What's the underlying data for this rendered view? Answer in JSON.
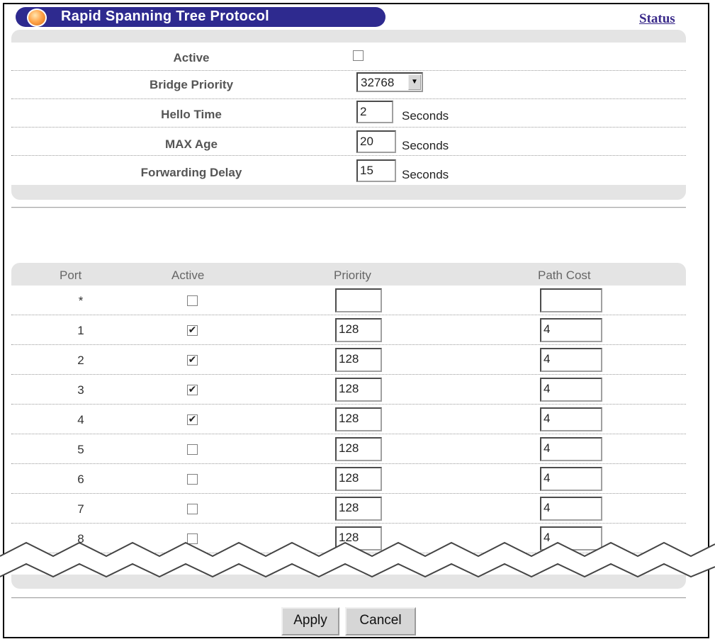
{
  "header": {
    "title": "Rapid Spanning Tree Protocol",
    "status_link": "Status"
  },
  "settings": {
    "active_label": "Active",
    "active_checked": false,
    "bridge_priority_label": "Bridge Priority",
    "bridge_priority_value": "32768",
    "hello_time_label": "Hello Time",
    "hello_time_value": "2",
    "max_age_label": "MAX Age",
    "max_age_value": "20",
    "forwarding_delay_label": "Forwarding Delay",
    "forwarding_delay_value": "15",
    "unit_seconds": "Seconds"
  },
  "ports_table": {
    "headers": {
      "port": "Port",
      "active": "Active",
      "priority": "Priority",
      "path_cost": "Path Cost"
    },
    "rows": [
      {
        "port": "*",
        "active": false,
        "priority": "",
        "path_cost": ""
      },
      {
        "port": "1",
        "active": true,
        "priority": "128",
        "path_cost": "4"
      },
      {
        "port": "2",
        "active": true,
        "priority": "128",
        "path_cost": "4"
      },
      {
        "port": "3",
        "active": true,
        "priority": "128",
        "path_cost": "4"
      },
      {
        "port": "4",
        "active": true,
        "priority": "128",
        "path_cost": "4"
      },
      {
        "port": "5",
        "active": false,
        "priority": "128",
        "path_cost": "4"
      },
      {
        "port": "6",
        "active": false,
        "priority": "128",
        "path_cost": "4"
      },
      {
        "port": "7",
        "active": false,
        "priority": "128",
        "path_cost": "4"
      },
      {
        "port": "8",
        "active": false,
        "priority": "128",
        "path_cost": "4"
      }
    ]
  },
  "buttons": {
    "apply": "Apply",
    "cancel": "Cancel"
  },
  "icons": {
    "title_ornament": "orange-ball-icon",
    "dropdown": "dropdown-arrow-icon",
    "checkmark": "checkmark-icon"
  },
  "colors": {
    "title_bar": "#2e2a8f",
    "panel_grey": "#e4e4e4",
    "status_link": "#3a2a8a"
  }
}
